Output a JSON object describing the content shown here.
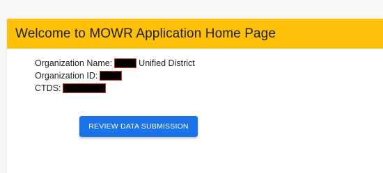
{
  "header": {
    "title": "Welcome to MOWR Application Home Page"
  },
  "organization": {
    "name_label": "Organization Name:",
    "name_suffix": "Unified District",
    "id_label": "Organization ID:",
    "ctds_label": "CTDS:"
  },
  "actions": {
    "review_label": "REVIEW DATA SUBMISSION"
  },
  "colors": {
    "header_bg": "#ffc107",
    "button_bg": "#1a73e8",
    "redaction": "#000000",
    "redaction_border": "#d32f2f"
  }
}
